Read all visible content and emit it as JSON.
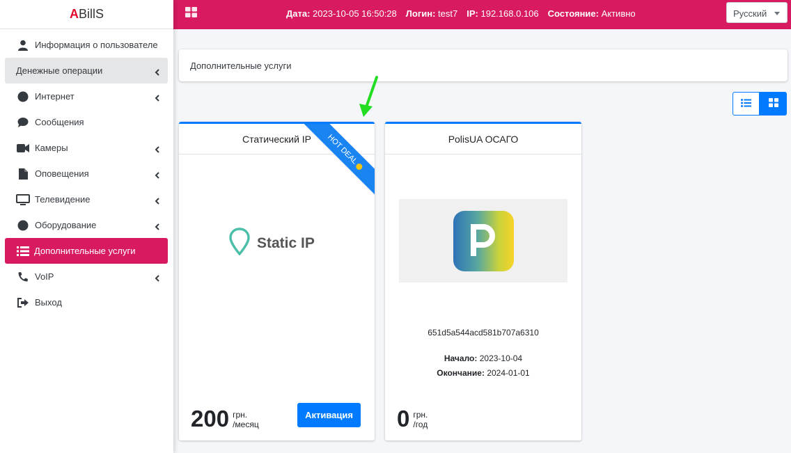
{
  "brand": {
    "accent": "A",
    "rest": "BillS"
  },
  "sidebar": {
    "items": [
      {
        "label": "Информация о пользователе",
        "icon": "user-icon"
      },
      {
        "label": "Денежные операции",
        "icon": "",
        "has_submenu": true
      },
      {
        "label": "Интернет",
        "icon": "globe-icon",
        "has_submenu": true
      },
      {
        "label": "Сообщения",
        "icon": "comment-icon"
      },
      {
        "label": "Камеры",
        "icon": "video-icon",
        "has_submenu": true
      },
      {
        "label": "Оповещения",
        "icon": "file-icon",
        "has_submenu": true
      },
      {
        "label": "Телевидение",
        "icon": "monitor-icon",
        "has_submenu": true
      },
      {
        "label": "Оборудование",
        "icon": "circle-icon",
        "has_submenu": true
      },
      {
        "label": "Дополнительные услуги",
        "icon": "list-icon",
        "active": true
      },
      {
        "label": "VoIP",
        "icon": "phone-icon",
        "has_submenu": true
      },
      {
        "label": "Выход",
        "icon": "sign-out-icon"
      }
    ]
  },
  "topbar": {
    "date_label": "Дата:",
    "date_value": "2023-10-05 16:50:28",
    "login_label": "Логин:",
    "login_value": "test7",
    "ip_label": "IP:",
    "ip_value": "192.168.0.106",
    "state_label": "Состояние:",
    "state_value": "Активно",
    "language": "Русский"
  },
  "breadcrumb": "Дополнительные услуги",
  "cards": [
    {
      "title": "Статический IP",
      "ribbon": "HOT DEAL",
      "logo_text": "Static IP",
      "price": "200",
      "currency": "грн.",
      "period": "/месяц",
      "button": "Активация"
    },
    {
      "title": "PolisUA ОСАГО",
      "id": "651d5a544acd581b707a6310",
      "start_label": "Начало:",
      "start_value": "2023-10-04",
      "end_label": "Окончание:",
      "end_value": "2024-01-01",
      "price": "0",
      "currency": "грн.",
      "period": "/год"
    }
  ],
  "colors": {
    "primary": "#007bff",
    "accent": "#d81b60",
    "arrow": "#22dd22"
  }
}
